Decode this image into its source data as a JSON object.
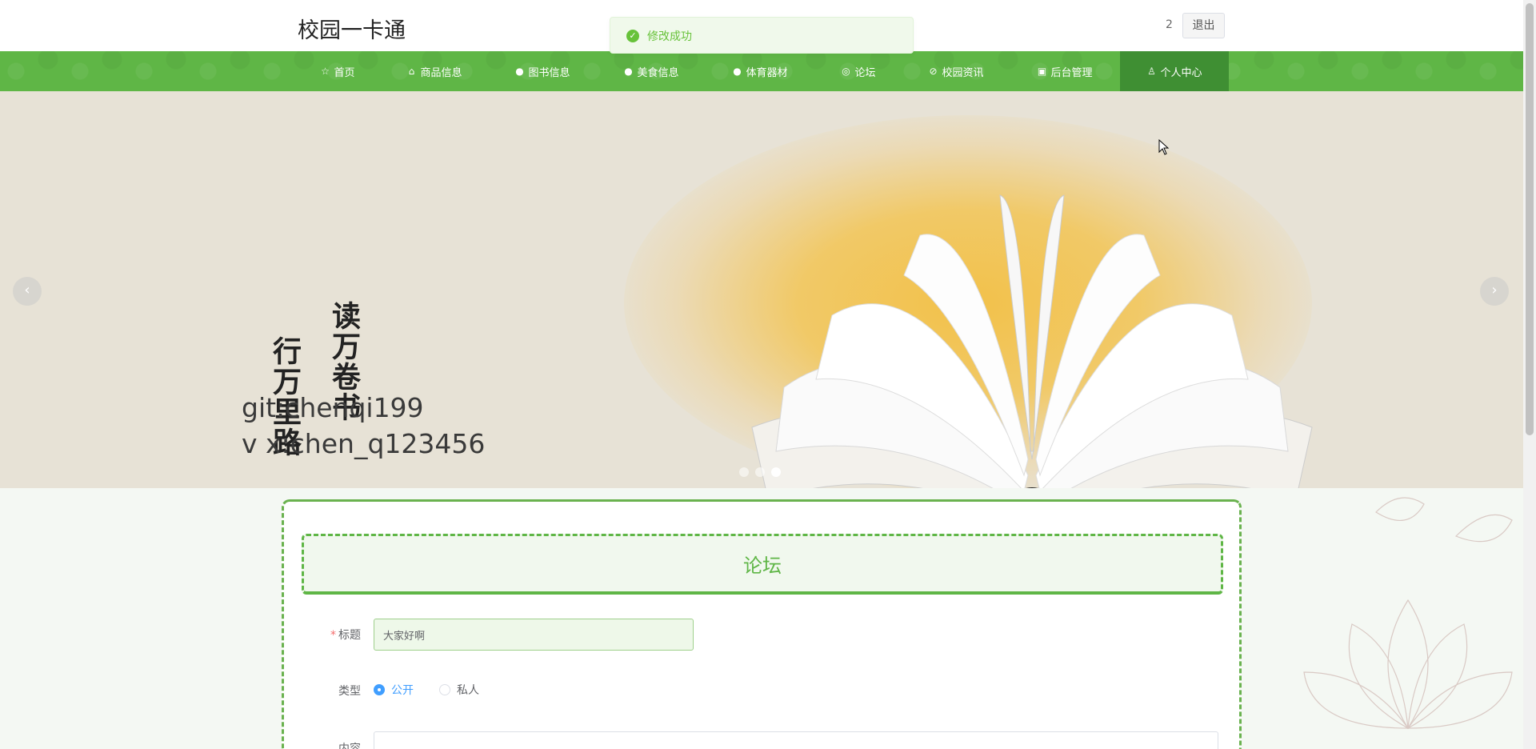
{
  "header": {
    "site_title": "校园一卡通",
    "user_number": "2",
    "logout_label": "退出"
  },
  "toast": {
    "message": "修改成功"
  },
  "nav": {
    "items": [
      {
        "label": "首页",
        "icon": "star-icon"
      },
      {
        "label": "商品信息",
        "icon": "bag-icon"
      },
      {
        "label": "图书信息",
        "icon": "info-icon"
      },
      {
        "label": "美食信息",
        "icon": "question-icon"
      },
      {
        "label": "体育器材",
        "icon": "info-icon"
      },
      {
        "label": "论坛",
        "icon": "globe-icon"
      },
      {
        "label": "校园资讯",
        "icon": "check-circle-icon"
      },
      {
        "label": "后台管理",
        "icon": "briefcase-icon"
      },
      {
        "label": "个人中心",
        "icon": "user-icon"
      }
    ],
    "active_index": 8
  },
  "banner": {
    "vertical_text_1": "读万卷书",
    "vertical_text_2": "行万里路",
    "git_line": "git:chenqi199",
    "vx_line": "v x:chen_q123456",
    "prev_label": "‹",
    "next_label": "›",
    "slide_count": 3,
    "active_slide": 2
  },
  "form": {
    "card_title": "论坛",
    "title_label": "标题",
    "title_value": "大家好啊",
    "type_label": "类型",
    "type_options": [
      "公开",
      "私人"
    ],
    "type_selected": "公开",
    "content_label": "内容"
  },
  "colors": {
    "primary_green": "#5fb646",
    "nav_active": "#3f8f33",
    "radio_blue": "#409eff",
    "toast_green": "#67c23a"
  }
}
